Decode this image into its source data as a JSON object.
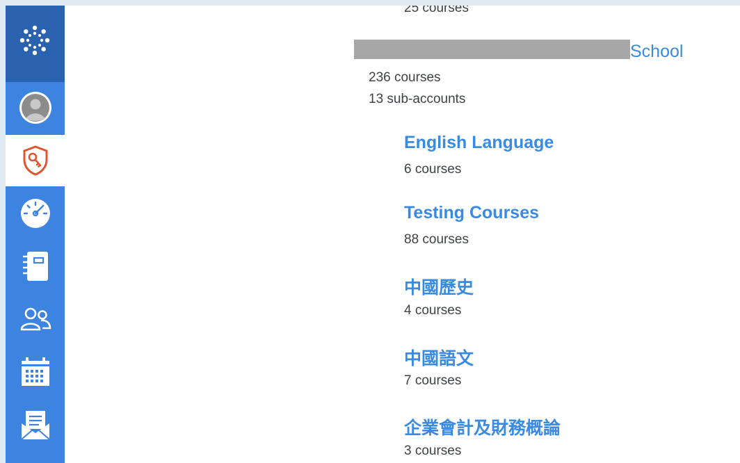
{
  "accounts": {
    "top_remainder": "25 courses",
    "parent": {
      "name_visible_suffix": "School",
      "courses": "236 courses",
      "subaccounts": "13 sub-accounts"
    },
    "children": [
      {
        "name": "English Language",
        "courses": "6 courses"
      },
      {
        "name": "Testing Courses",
        "courses": "88 courses"
      },
      {
        "name": "中國歷史",
        "courses": "4 courses"
      },
      {
        "name": "中國語文",
        "courses": "7 courses"
      },
      {
        "name": "企業會計及財務概論",
        "courses": "3 courses"
      }
    ]
  },
  "colors": {
    "sidebar": "#3d83e0",
    "sidebar_dark": "#2a62b0",
    "link": "#3a8ae0",
    "active_icon": "#e0542f"
  },
  "sidebar_icons": [
    "canvas-logo-icon",
    "avatar-icon",
    "admin-shield-icon",
    "dashboard-icon",
    "courses-icon",
    "groups-icon",
    "calendar-icon",
    "inbox-icon"
  ]
}
